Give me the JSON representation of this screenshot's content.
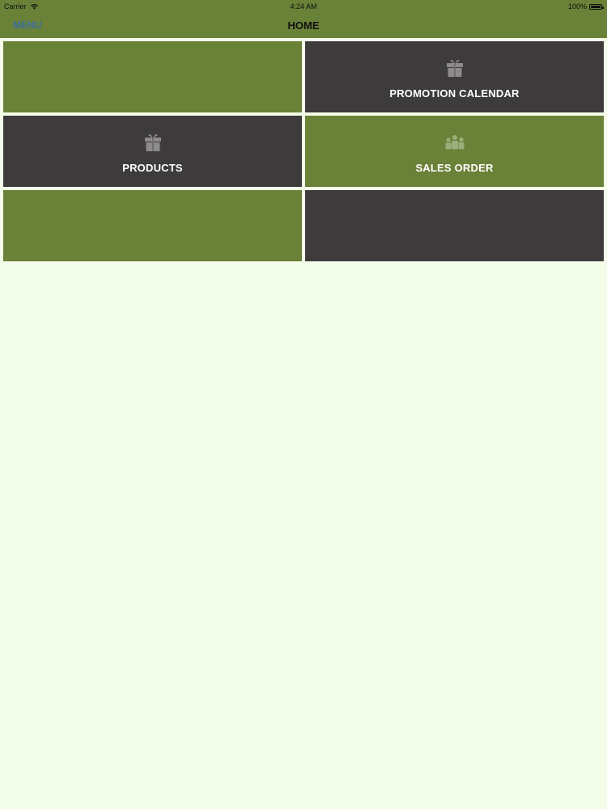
{
  "status_bar": {
    "carrier": "Carrier",
    "time": "4:24 AM",
    "battery": "100%",
    "battery_level": 1.0,
    "wifi_icon": "wifi-icon",
    "battery_icon": "battery-icon"
  },
  "navbar": {
    "menu_label": "MENU",
    "title": "HOME"
  },
  "colors": {
    "background": "#F4FDE9",
    "bar": "#6A8138",
    "tile_green": "#6A8138",
    "tile_dark": "#3E3B3C",
    "menu_text": "#3E6F9F",
    "icon_on_dark": "#8C8A8B",
    "icon_on_green": "#9AB07B"
  },
  "tiles": [
    {
      "label": "",
      "icon": "",
      "style": "green"
    },
    {
      "label": "PROMOTION CALENDAR",
      "icon": "gift-icon",
      "style": "dark"
    },
    {
      "label": "PRODUCTS",
      "icon": "gift-icon",
      "style": "dark"
    },
    {
      "label": "SALES ORDER",
      "icon": "group-icon",
      "style": "green"
    },
    {
      "label": "",
      "icon": "",
      "style": "green"
    },
    {
      "label": "",
      "icon": "",
      "style": "dark"
    }
  ]
}
